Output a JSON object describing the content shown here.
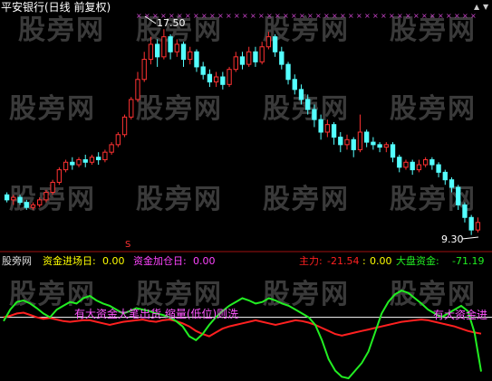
{
  "title": "平安银行(日线 前复权)",
  "window_controls": {
    "up": "▲",
    "down": "▼"
  },
  "watermark": "股旁网",
  "colors": {
    "up": "#ff3232",
    "down": "#54ffff",
    "main_force": "#ff2020",
    "market_funds": "#22ee22",
    "white": "#ffffff",
    "magenta": "#ff44ff",
    "yellow": "#ffff00",
    "xmark": "#cc44cc"
  },
  "price_panel": {
    "high_label": "17.50",
    "low_label": "9.30",
    "signal_marker": "S",
    "price_range": [
      9.0,
      17.8
    ],
    "candles": [
      [
        10.9,
        10.7,
        11.0,
        10.6
      ],
      [
        10.7,
        10.8,
        10.9,
        10.5
      ],
      [
        10.8,
        10.6,
        10.9,
        10.5
      ],
      [
        10.6,
        10.4,
        10.7,
        10.3
      ],
      [
        10.4,
        10.5,
        10.6,
        10.3
      ],
      [
        10.5,
        10.7,
        10.8,
        10.4
      ],
      [
        10.7,
        11.0,
        11.1,
        10.6
      ],
      [
        11.0,
        11.4,
        11.5,
        10.9
      ],
      [
        11.4,
        11.9,
        12.0,
        11.3
      ],
      [
        11.9,
        12.2,
        12.3,
        11.8
      ],
      [
        12.2,
        12.1,
        12.4,
        11.9
      ],
      [
        12.1,
        12.3,
        12.4,
        12.0
      ],
      [
        12.3,
        12.2,
        12.5,
        12.0
      ],
      [
        12.2,
        12.4,
        12.5,
        12.1
      ],
      [
        12.4,
        12.3,
        12.6,
        12.1
      ],
      [
        12.3,
        12.6,
        12.7,
        12.2
      ],
      [
        12.6,
        12.9,
        13.0,
        12.5
      ],
      [
        12.9,
        13.3,
        13.4,
        12.8
      ],
      [
        13.3,
        14.0,
        14.1,
        13.2
      ],
      [
        14.0,
        14.7,
        14.8,
        13.9
      ],
      [
        14.7,
        15.5,
        15.8,
        14.6
      ],
      [
        15.5,
        16.3,
        16.6,
        15.4
      ],
      [
        16.3,
        16.9,
        17.2,
        16.1
      ],
      [
        16.9,
        16.4,
        17.1,
        16.0
      ],
      [
        16.4,
        17.2,
        17.5,
        16.3
      ],
      [
        17.2,
        16.6,
        17.3,
        16.3
      ],
      [
        16.6,
        16.9,
        17.1,
        16.4
      ],
      [
        16.9,
        16.3,
        17.0,
        16.0
      ],
      [
        16.3,
        16.6,
        16.8,
        16.1
      ],
      [
        16.6,
        16.0,
        16.7,
        15.8
      ],
      [
        16.0,
        15.7,
        16.2,
        15.5
      ],
      [
        15.7,
        15.4,
        15.9,
        15.2
      ],
      [
        15.4,
        15.6,
        15.8,
        15.2
      ],
      [
        15.6,
        15.3,
        15.8,
        15.1
      ],
      [
        15.3,
        15.9,
        16.0,
        15.2
      ],
      [
        15.9,
        16.4,
        16.6,
        15.8
      ],
      [
        16.4,
        16.1,
        16.6,
        15.9
      ],
      [
        16.1,
        16.6,
        16.8,
        16.0
      ],
      [
        16.6,
        16.2,
        16.8,
        16.0
      ],
      [
        16.2,
        16.8,
        17.0,
        16.1
      ],
      [
        16.8,
        17.2,
        17.4,
        16.7
      ],
      [
        17.2,
        16.6,
        17.3,
        16.4
      ],
      [
        16.6,
        16.1,
        16.8,
        15.9
      ],
      [
        16.1,
        15.5,
        16.2,
        15.3
      ],
      [
        15.5,
        15.1,
        15.7,
        14.9
      ],
      [
        15.1,
        14.7,
        15.3,
        14.5
      ],
      [
        14.7,
        14.3,
        14.9,
        14.1
      ],
      [
        14.3,
        13.9,
        14.5,
        13.6
      ],
      [
        13.9,
        13.4,
        14.1,
        13.1
      ],
      [
        13.4,
        13.7,
        13.9,
        13.2
      ],
      [
        13.7,
        13.2,
        13.8,
        12.9
      ],
      [
        13.2,
        12.9,
        13.4,
        12.6
      ],
      [
        12.9,
        13.1,
        13.3,
        12.7
      ],
      [
        13.1,
        12.7,
        13.2,
        12.4
      ],
      [
        12.7,
        13.4,
        14.1,
        12.6
      ],
      [
        13.4,
        13.0,
        13.5,
        12.8
      ],
      [
        13.0,
        12.9,
        13.2,
        12.7
      ],
      [
        12.9,
        12.8,
        13.0,
        12.6
      ],
      [
        12.8,
        12.9,
        13.0,
        12.6
      ],
      [
        12.9,
        12.4,
        13.0,
        12.2
      ],
      [
        12.4,
        12.0,
        12.5,
        11.8
      ],
      [
        12.0,
        12.2,
        12.3,
        11.9
      ],
      [
        12.2,
        11.9,
        12.3,
        11.7
      ],
      [
        11.9,
        12.1,
        12.3,
        11.8
      ],
      [
        12.1,
        12.3,
        12.4,
        12.0
      ],
      [
        12.3,
        12.1,
        12.4,
        11.9
      ],
      [
        12.1,
        11.8,
        12.2,
        11.6
      ],
      [
        11.8,
        11.5,
        11.9,
        11.3
      ],
      [
        11.5,
        11.2,
        11.6,
        11.0
      ],
      [
        11.2,
        10.5,
        11.3,
        10.3
      ],
      [
        10.5,
        10.0,
        10.6,
        9.8
      ],
      [
        10.0,
        9.5,
        10.1,
        9.3
      ],
      [
        9.5,
        9.8,
        10.0,
        9.4
      ]
    ]
  },
  "indicator_panel": {
    "label_site": "股旁网",
    "label_entry_day": "资金进场日:",
    "value_entry_day": "0.00",
    "label_add_day": "资金加仓日:",
    "value_add_day": "0.00",
    "label_main_force": "主力:",
    "value_main_force": "-21.54",
    "sep_colon": ":",
    "value_mid": "0.00",
    "label_market_funds": "大盘资金:",
    "value_market_funds": "-71.19",
    "annotation_left": "有大资金大笔出货 缩量(低位)则洗",
    "annotation_right": "有大资金进",
    "series_range": [
      -80,
      60
    ],
    "main_force_series": [
      0,
      2,
      5,
      6,
      3,
      0,
      -2,
      -1,
      -3,
      -5,
      -6,
      -5,
      -4,
      -4,
      -6,
      -8,
      -10,
      -8,
      -6,
      -5,
      -4,
      -3,
      -5,
      -6,
      -4,
      -3,
      -5,
      -8,
      -12,
      -18,
      -22,
      -25,
      -20,
      -15,
      -12,
      -10,
      -8,
      -6,
      -4,
      -6,
      -8,
      -10,
      -8,
      -6,
      -4,
      -5,
      -7,
      -10,
      -14,
      -18,
      -22,
      -24,
      -22,
      -20,
      -18,
      -16,
      -14,
      -12,
      -10,
      -8,
      -6,
      -5,
      -4,
      -3,
      -4,
      -6,
      -8,
      -10,
      -12,
      -15,
      -18,
      -20,
      -21.54
    ],
    "market_funds_series": [
      -5,
      10,
      20,
      22,
      18,
      12,
      5,
      0,
      10,
      15,
      20,
      18,
      25,
      28,
      22,
      18,
      15,
      10,
      5,
      8,
      12,
      10,
      8,
      5,
      3,
      0,
      -5,
      -12,
      -25,
      -30,
      -22,
      -10,
      0,
      8,
      15,
      20,
      25,
      22,
      18,
      20,
      25,
      22,
      18,
      15,
      10,
      5,
      0,
      -10,
      -30,
      -55,
      -70,
      -78,
      -80,
      -70,
      -60,
      -45,
      -20,
      5,
      20,
      30,
      35,
      32,
      25,
      18,
      10,
      5,
      0,
      5,
      10,
      15,
      8,
      -20,
      -71.19
    ]
  }
}
